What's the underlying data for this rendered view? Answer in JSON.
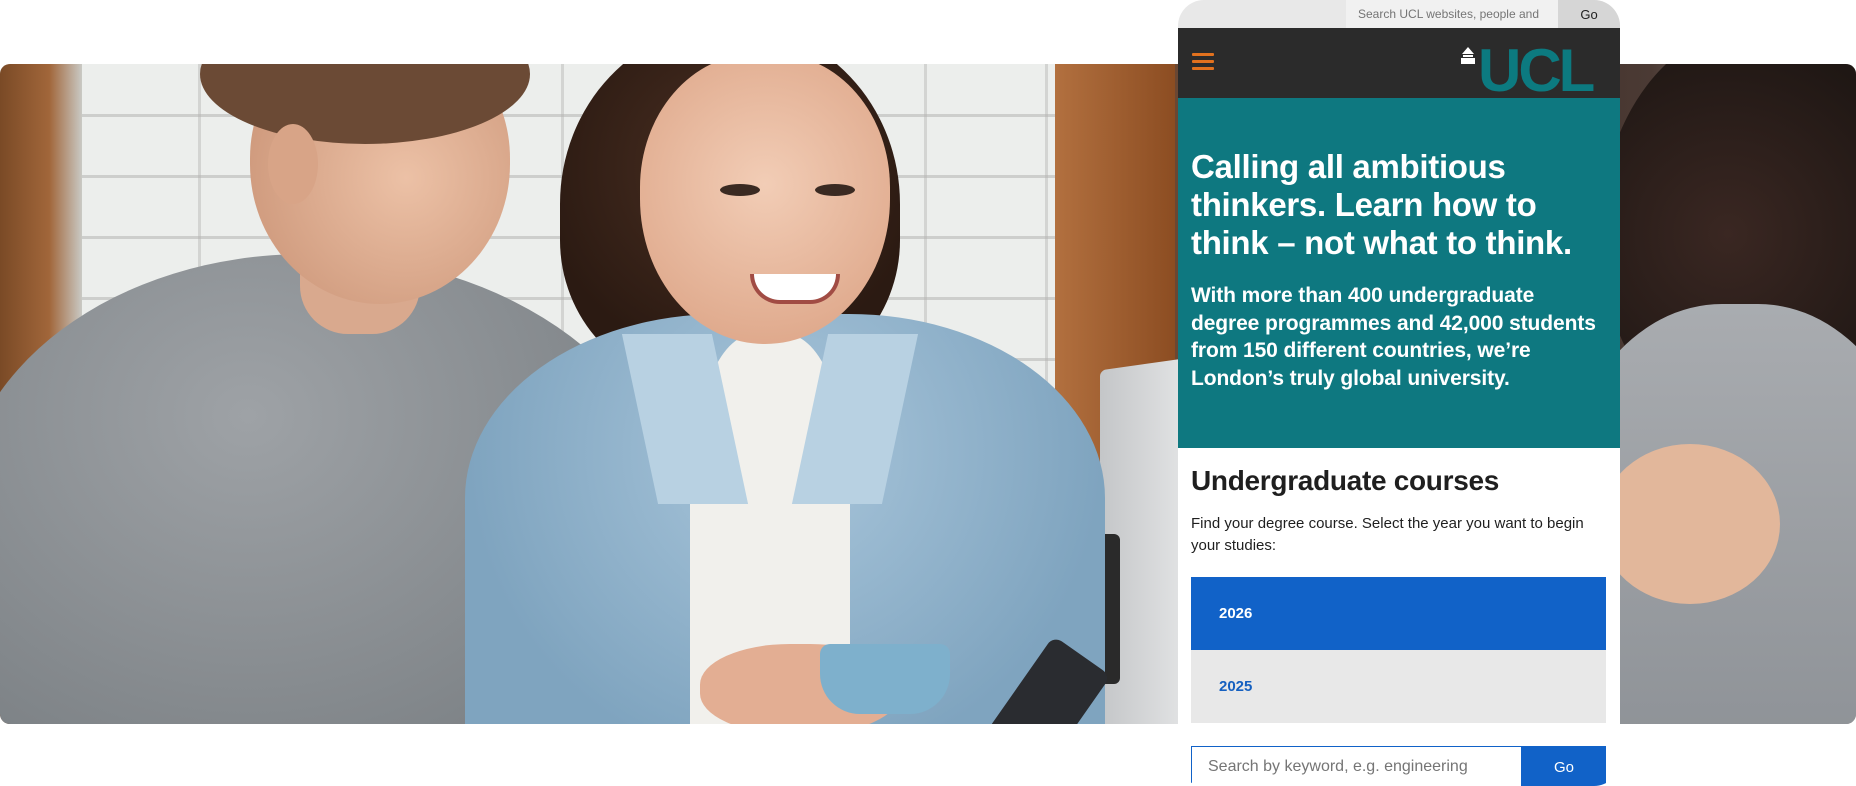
{
  "utility_bar": {
    "search_placeholder": "Search UCL websites, people and",
    "go_label": "Go"
  },
  "header": {
    "logo_text": "UCL",
    "brand_color": "#0c7a80",
    "menu_icon": "hamburger-menu-icon",
    "accent_color": "#e1711e"
  },
  "hero": {
    "headline": "Calling all ambitious thinkers. Learn how to think – not what to think.",
    "subtext": "With more than 400 undergraduate degree programmes and 42,000 students from 150 different countries, we’re London’s truly global university.",
    "background_color": "#0e7880"
  },
  "courses": {
    "title": "Undergraduate courses",
    "intro": "Find your degree course. Select the year you want to begin your studies:",
    "years": [
      {
        "label": "2026",
        "selected": true
      },
      {
        "label": "2025",
        "selected": false
      }
    ],
    "search": {
      "placeholder": "Search by keyword, e.g. engineering",
      "button_label": "Go"
    },
    "primary_color": "#1162c8"
  }
}
